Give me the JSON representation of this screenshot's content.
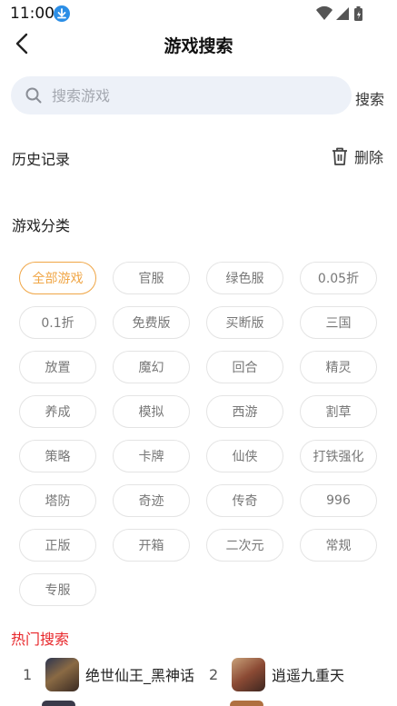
{
  "status_bar": {
    "time": "11:00",
    "icons": [
      "download-icon",
      "wifi-icon",
      "signal-icon",
      "battery-icon"
    ]
  },
  "header": {
    "title": "游戏搜索",
    "back_icon": "chevron-left-icon"
  },
  "search": {
    "placeholder": "搜索游戏",
    "value": "",
    "button_label": "搜索"
  },
  "history": {
    "title": "历史记录",
    "delete_label": "删除"
  },
  "categories": {
    "title": "游戏分类",
    "active_index": 0,
    "tags": [
      "全部游戏",
      "官服",
      "绿色服",
      "0.05折",
      "0.1折",
      "免费版",
      "买断版",
      "三国",
      "放置",
      "魔幻",
      "回合",
      "精灵",
      "养成",
      "模拟",
      "西游",
      "割草",
      "策略",
      "卡牌",
      "仙侠",
      "打铁强化",
      "塔防",
      "奇迹",
      "传奇",
      "996",
      "正版",
      "开箱",
      "二次元",
      "常规",
      "专服"
    ]
  },
  "hot": {
    "title": "热门搜索",
    "items": [
      {
        "rank": "1",
        "name": "绝世仙王_黑神话"
      },
      {
        "rank": "2",
        "name": "逍遥九重天"
      }
    ]
  },
  "colors": {
    "accent": "#f0a646",
    "hot_title": "#e8272b",
    "search_bg": "#edf1f8",
    "download_badge": "#2b8ee6"
  }
}
